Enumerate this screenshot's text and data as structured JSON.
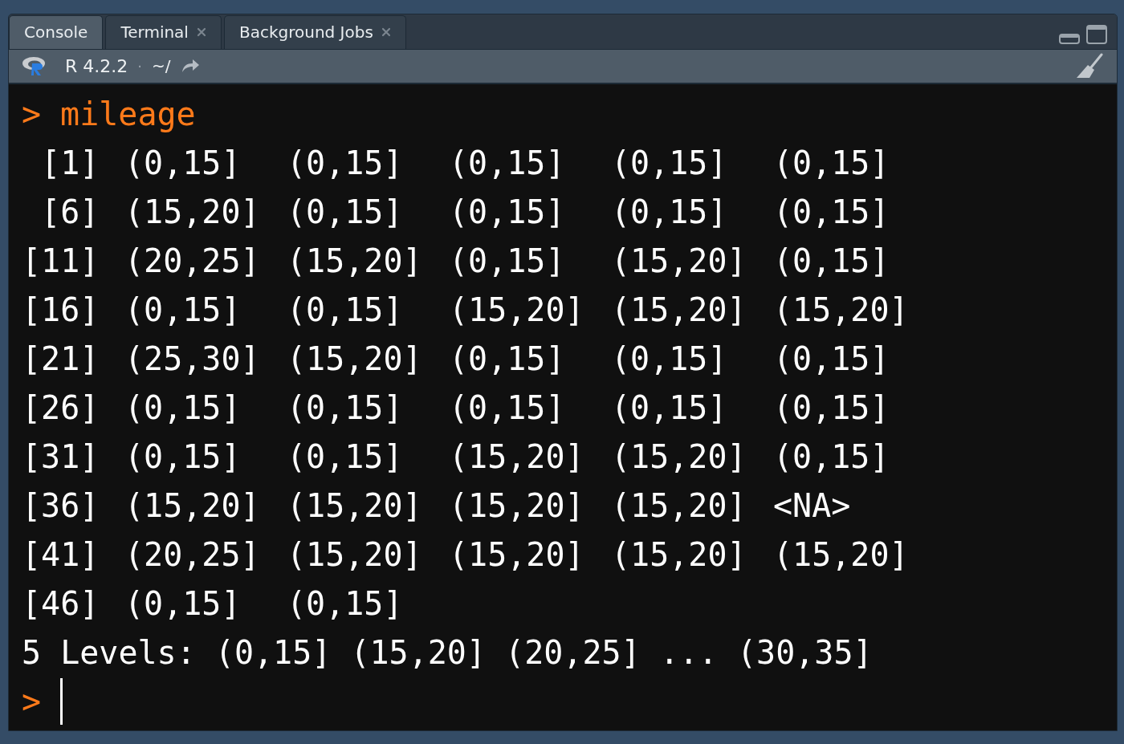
{
  "tabs": [
    {
      "label": "Console",
      "selected": true,
      "closable": false
    },
    {
      "label": "Terminal",
      "selected": false,
      "closable": true
    },
    {
      "label": "Background Jobs",
      "selected": false,
      "closable": true
    }
  ],
  "toolbar": {
    "version": "R 4.2.2",
    "separator": "·",
    "path": "~/"
  },
  "console": {
    "command": {
      "prompt": ">",
      "text": "mileage"
    },
    "rows": [
      {
        "index": " [1]",
        "cells": [
          "(0,15]",
          "(0,15]",
          "(0,15]",
          "(0,15]",
          "(0,15]"
        ]
      },
      {
        "index": " [6]",
        "cells": [
          "(15,20]",
          "(0,15]",
          "(0,15]",
          "(0,15]",
          "(0,15]"
        ]
      },
      {
        "index": "[11]",
        "cells": [
          "(20,25]",
          "(15,20]",
          "(0,15]",
          "(15,20]",
          "(0,15]"
        ]
      },
      {
        "index": "[16]",
        "cells": [
          "(0,15]",
          "(0,15]",
          "(15,20]",
          "(15,20]",
          "(15,20]"
        ]
      },
      {
        "index": "[21]",
        "cells": [
          "(25,30]",
          "(15,20]",
          "(0,15]",
          "(0,15]",
          "(0,15]"
        ]
      },
      {
        "index": "[26]",
        "cells": [
          "(0,15]",
          "(0,15]",
          "(0,15]",
          "(0,15]",
          "(0,15]"
        ]
      },
      {
        "index": "[31]",
        "cells": [
          "(0,15]",
          "(0,15]",
          "(15,20]",
          "(15,20]",
          "(0,15]"
        ]
      },
      {
        "index": "[36]",
        "cells": [
          "(15,20]",
          "(15,20]",
          "(15,20]",
          "(15,20]",
          "<NA>"
        ]
      },
      {
        "index": "[41]",
        "cells": [
          "(20,25]",
          "(15,20]",
          "(15,20]",
          "(15,20]",
          "(15,20]"
        ]
      },
      {
        "index": "[46]",
        "cells": [
          "(0,15]",
          "(0,15]"
        ]
      }
    ],
    "levels": "5 Levels: (0,15] (15,20] (20,25] ... (30,35]",
    "input_prompt": ">"
  }
}
